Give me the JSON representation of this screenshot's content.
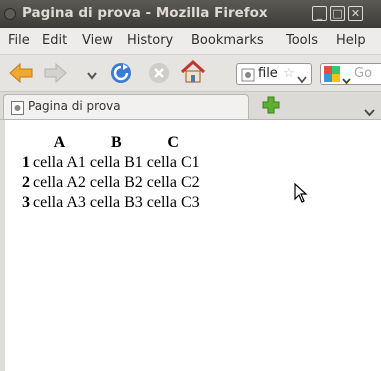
{
  "window": {
    "title": "Pagina di prova - Mozilla Firefox",
    "controls": [
      "_",
      "□",
      "✕"
    ]
  },
  "menu": [
    "File",
    "Edit",
    "View",
    "History",
    "Bookmarks",
    "Tools",
    "Help"
  ],
  "navbar": {
    "url_text": "file",
    "search_placeholder": "Go"
  },
  "tab": {
    "title": "Pagina di prova"
  },
  "table": {
    "headers": [
      "A",
      "B",
      "C"
    ],
    "rows": [
      {
        "label": "1",
        "cells": [
          "cella A1",
          "cella B1",
          "cella C1"
        ]
      },
      {
        "label": "2",
        "cells": [
          "cella A2",
          "cella B2",
          "cella C2"
        ]
      },
      {
        "label": "3",
        "cells": [
          "cella A3",
          "cella B3",
          "cella C3"
        ]
      }
    ]
  },
  "colors": {
    "titlebar": "#3c3b37",
    "title_text": "#dfdbd2",
    "back_arrow": "#f0a830",
    "reload": "#3a7bd5",
    "home_roof": "#c0392b",
    "new_tab_plus": "#5cb130"
  }
}
